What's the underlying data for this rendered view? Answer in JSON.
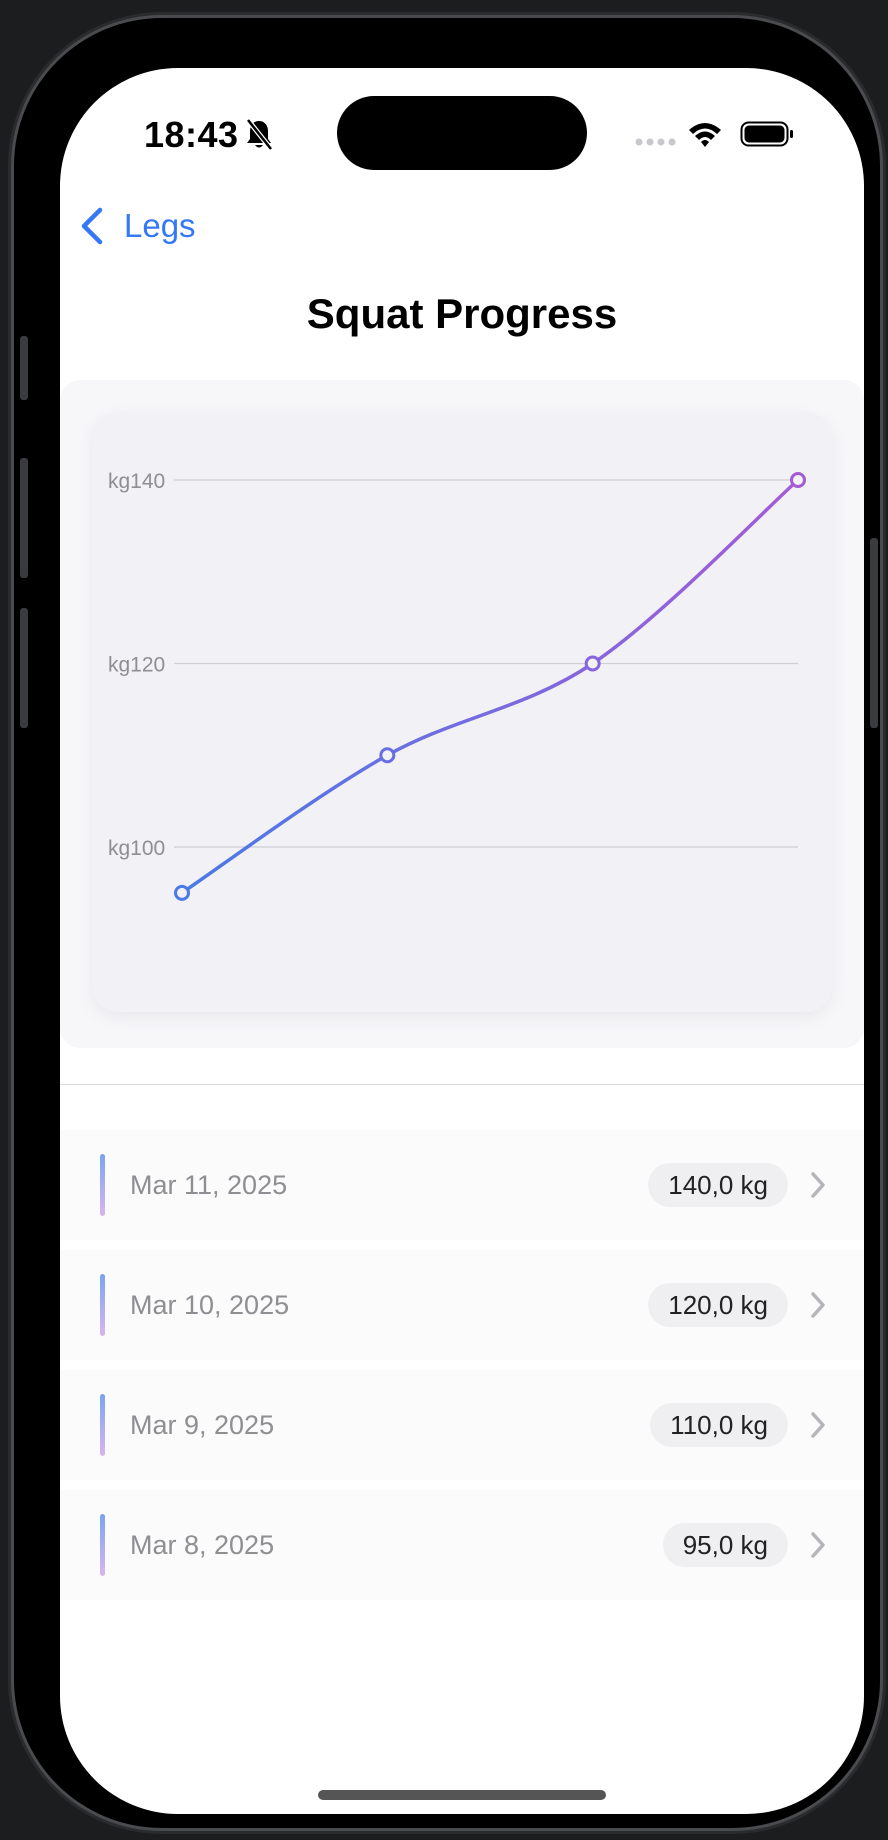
{
  "status_bar": {
    "time": "18:43"
  },
  "nav": {
    "back_label": "Legs",
    "title": "Squat Progress"
  },
  "chart_data": {
    "type": "line",
    "title": "",
    "xlabel": "",
    "ylabel": "",
    "yticks": [
      {
        "value": 140,
        "label": "kg140"
      },
      {
        "value": 120,
        "label": "kg120"
      },
      {
        "value": 100,
        "label": "kg100"
      }
    ],
    "ylim": [
      95,
      140
    ],
    "x": [
      "Mar 8, 2025",
      "Mar 9, 2025",
      "Mar 10, 2025",
      "Mar 11, 2025"
    ],
    "values": [
      95,
      110,
      120,
      140
    ],
    "grid": true,
    "colors": {
      "start": "#4a7ae6",
      "end": "#a45bd8",
      "grid": "#cfcfd4",
      "tick": "#8e8e93"
    }
  },
  "history": [
    {
      "date": "Mar 11, 2025",
      "value": "140,0 kg"
    },
    {
      "date": "Mar 10, 2025",
      "value": "120,0 kg"
    },
    {
      "date": "Mar 9, 2025",
      "value": "110,0 kg"
    },
    {
      "date": "Mar 8, 2025",
      "value": "95,0 kg"
    }
  ],
  "colors": {
    "accent": "#3478f6"
  }
}
